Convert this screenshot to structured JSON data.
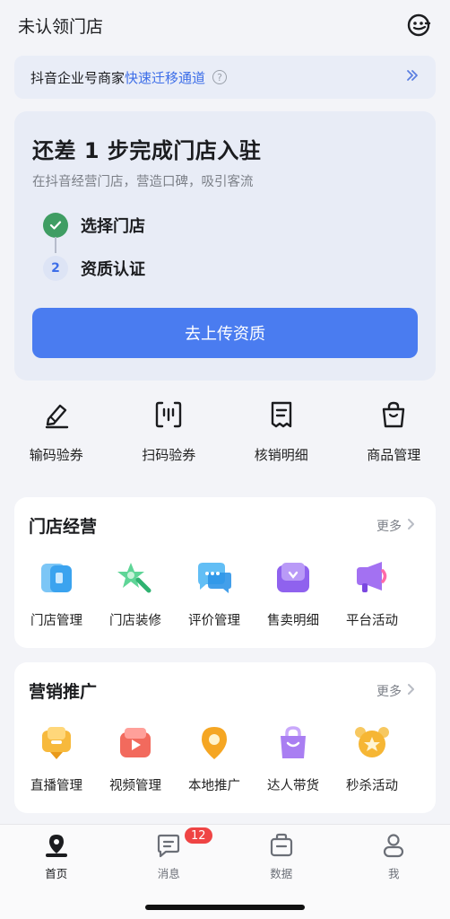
{
  "header": {
    "title": "未认领门店",
    "icon": "face-icon"
  },
  "migrate": {
    "prefix": "抖音企业号商家",
    "link": "快速迁移通道",
    "help_icon": "?",
    "chevron": "»"
  },
  "setup": {
    "title": "还差 1 步完成门店入驻",
    "subtitle": "在抖音经营门店，营造口碑，吸引客流",
    "steps": [
      {
        "number": "",
        "label": "选择门店",
        "status": "done"
      },
      {
        "number": "2",
        "label": "资质认证",
        "status": "pending"
      }
    ],
    "button": "去上传资质"
  },
  "quick": [
    {
      "label": "输码验券",
      "icon": "pencil-icon"
    },
    {
      "label": "扫码验券",
      "icon": "scan-icon"
    },
    {
      "label": "核销明细",
      "icon": "receipt-icon"
    },
    {
      "label": "商品管理",
      "icon": "bag-icon"
    }
  ],
  "store_ops": {
    "title": "门店经营",
    "more": "更多",
    "items": [
      {
        "label": "门店管理",
        "icon": "store-manage-icon",
        "color": "#4fb4f2"
      },
      {
        "label": "门店装修",
        "icon": "store-decor-icon",
        "color": "#4cc98a"
      },
      {
        "label": "评价管理",
        "icon": "review-icon",
        "color": "#40a8ee"
      },
      {
        "label": "售卖明细",
        "icon": "sales-detail-icon",
        "color": "#9a6bf0"
      },
      {
        "label": "平台活动",
        "icon": "megaphone-icon",
        "color": "#a874f2"
      }
    ]
  },
  "marketing": {
    "title": "营销推广",
    "more": "更多",
    "items": [
      {
        "label": "直播管理",
        "icon": "live-icon",
        "color": "#f6b634"
      },
      {
        "label": "视频管理",
        "icon": "video-icon",
        "color": "#f2675c"
      },
      {
        "label": "本地推广",
        "icon": "location-pin-icon",
        "color": "#f5a623"
      },
      {
        "label": "达人带货",
        "icon": "shopping-bag-icon",
        "color": "#a97ef2"
      },
      {
        "label": "秒杀活动",
        "icon": "alarm-clock-icon",
        "color": "#f6b634"
      }
    ]
  },
  "tabbar": {
    "tabs": [
      {
        "label": "首页",
        "icon": "home-icon",
        "active": true
      },
      {
        "label": "消息",
        "icon": "message-icon",
        "active": false
      },
      {
        "label": "数据",
        "icon": "data-icon",
        "active": false
      },
      {
        "label": "我",
        "icon": "profile-icon",
        "active": false
      }
    ],
    "message_badge": "12"
  },
  "colors": {
    "primary": "#4a7cf0",
    "success": "#3f9d63",
    "badge": "#ef4444"
  }
}
